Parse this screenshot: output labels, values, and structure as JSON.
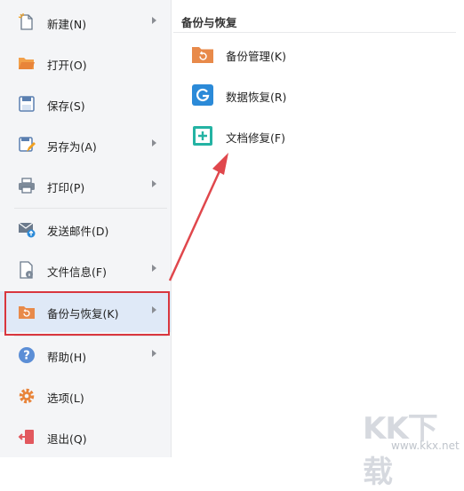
{
  "menu": {
    "items": [
      {
        "label": "新建(N)",
        "icon": "new-file-icon",
        "has_submenu": true
      },
      {
        "label": "打开(O)",
        "icon": "open-folder-icon",
        "has_submenu": false
      },
      {
        "label": "保存(S)",
        "icon": "save-icon",
        "has_submenu": false
      },
      {
        "label": "另存为(A)",
        "icon": "save-as-icon",
        "has_submenu": true
      },
      {
        "label": "打印(P)",
        "icon": "printer-icon",
        "has_submenu": true
      },
      {
        "label": "发送邮件(D)",
        "icon": "send-mail-icon",
        "has_submenu": false
      },
      {
        "label": "文件信息(F)",
        "icon": "file-info-icon",
        "has_submenu": true
      },
      {
        "label": "备份与恢复(K)",
        "icon": "backup-restore-icon",
        "has_submenu": true,
        "active": true
      },
      {
        "label": "帮助(H)",
        "icon": "help-icon",
        "has_submenu": true
      },
      {
        "label": "选项(L)",
        "icon": "options-gear-icon",
        "has_submenu": false
      },
      {
        "label": "退出(Q)",
        "icon": "exit-icon",
        "has_submenu": false
      }
    ]
  },
  "submenu": {
    "title": "备份与恢复",
    "items": [
      {
        "label": "备份管理(K)",
        "icon": "backup-management-icon"
      },
      {
        "label": "数据恢复(R)",
        "icon": "data-recovery-icon"
      },
      {
        "label": "文档修复(F)",
        "icon": "document-repair-icon"
      }
    ]
  },
  "watermark": {
    "text": "KK下载",
    "url": "www.kkx.net"
  },
  "colors": {
    "highlight_border": "#d9363e",
    "active_bg": "#dfe9f7",
    "menu_bg": "#f4f5f7",
    "accent_orange": "#e88a4a",
    "accent_blue": "#2b8ad8",
    "accent_teal": "#24b3a3"
  }
}
